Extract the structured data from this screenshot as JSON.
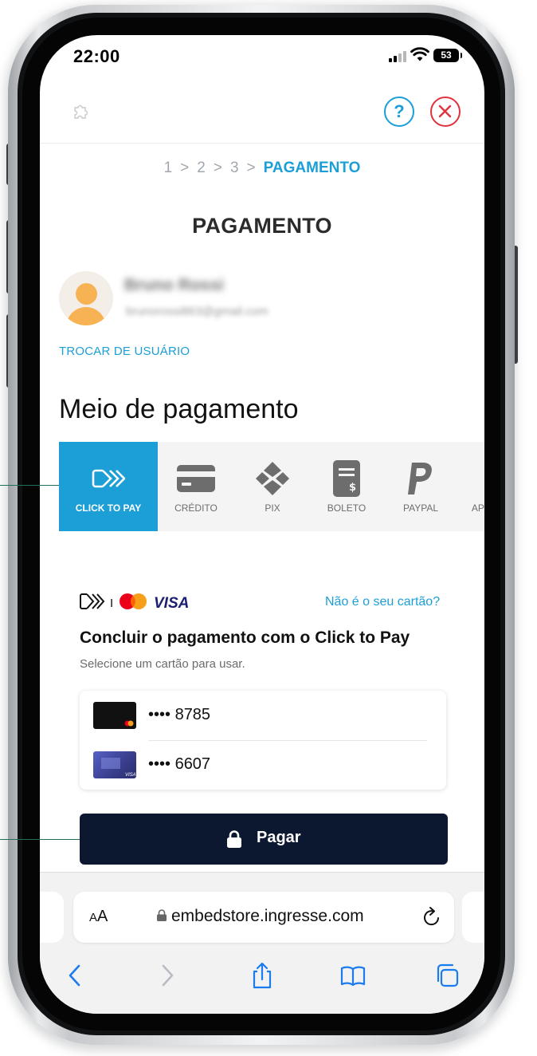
{
  "status_bar": {
    "time": "22:00",
    "battery": "53"
  },
  "header": {
    "help_label": "?"
  },
  "stepper": {
    "steps": [
      "1",
      "2",
      "3"
    ],
    "separator": ">",
    "current": "PAGAMENTO"
  },
  "page": {
    "title": "PAGAMENTO"
  },
  "user": {
    "name": "Bruno Rossi",
    "email": "brunorossi863@gmail.com",
    "switch_label": "TROCAR DE USUÁRIO"
  },
  "payment_section": {
    "title": "Meio de pagamento",
    "methods": [
      {
        "label": "CLICK TO PAY",
        "icon": "click-to-pay-icon",
        "active": true
      },
      {
        "label": "CRÉDITO",
        "icon": "credit-card-icon",
        "active": false
      },
      {
        "label": "PIX",
        "icon": "pix-icon",
        "active": false
      },
      {
        "label": "BOLETO",
        "icon": "boleto-icon",
        "active": false
      },
      {
        "label": "PAYPAL",
        "icon": "paypal-icon",
        "active": false
      },
      {
        "label": "APPLE PAY",
        "icon": "apple-pay-icon",
        "active": false
      }
    ]
  },
  "click_to_pay": {
    "brand_visa": "VISA",
    "brand_separator": "I",
    "not_your_card": "Não é o seu cartão?",
    "title": "Concluir o pagamento com o Click to Pay",
    "subtitle": "Selecione um cartão para usar.",
    "cards": [
      {
        "number": "•••• 8785",
        "brand": "mastercard"
      },
      {
        "number": "•••• 6607",
        "brand": "visa"
      }
    ],
    "pay_button": "Pagar"
  },
  "browser": {
    "aa_small": "A",
    "aa_large": "A",
    "url": "embedstore.ingresse.com"
  },
  "colors": {
    "accent": "#1c9fd6",
    "close": "#e0333d",
    "pay_button": "#0b1830"
  }
}
